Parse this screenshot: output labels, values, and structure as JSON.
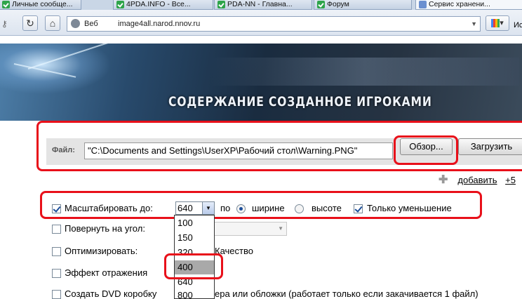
{
  "browser": {
    "tabs": [
      {
        "label": "Личные сообще...",
        "icon": "check-favicon"
      },
      {
        "label": "4PDA.INFO - Все...",
        "icon": "check-favicon"
      },
      {
        "label": "PDA-NN - Главна...",
        "icon": "check-favicon"
      },
      {
        "label": "Форум",
        "icon": "check-favicon"
      },
      {
        "label": "Сервис хранени...",
        "icon": "page-favicon"
      }
    ],
    "address_bar": {
      "label": "Веб",
      "url": "image4all.narod.nnov.ru"
    },
    "right_label": "Ис"
  },
  "banner": {
    "title": "СОДЕРЖАНИЕ СОЗДАННОЕ ИГРОКАМИ"
  },
  "upload": {
    "file_label": "Файл:",
    "file_value": "\"C:\\Documents and Settings\\UserXP\\Рабочий стол\\Warning.PNG\"",
    "browse_label": "Обзор...",
    "upload_label": "Загрузить",
    "add_label": "добавить",
    "add_extra": "+5"
  },
  "options": {
    "scale": {
      "label": "Масштабировать до:",
      "checked": true,
      "value": "640",
      "by_label": "по",
      "width_label": "ширине",
      "height_label": "высоте",
      "width_selected": true,
      "shrink_label": "Только уменьшение",
      "shrink_checked": true
    },
    "size_options": [
      "100",
      "150",
      "320",
      "400",
      "640",
      "800"
    ],
    "highlighted_option": "400",
    "rotate": {
      "label": "Повернуть на угол:",
      "checked": false
    },
    "optimize": {
      "label": "Оптимизировать:",
      "checked": false,
      "quality_label": "Качество"
    },
    "reflection": {
      "label": "Эффект отражения",
      "checked": false
    },
    "dvd": {
      "label": "Создать DVD коробку",
      "rest": "ера или обложки (работает только если закачивается 1 файл)",
      "checked": false
    }
  },
  "colors": {
    "highlight": "#e8101a",
    "accent": "#1c4e9a"
  }
}
